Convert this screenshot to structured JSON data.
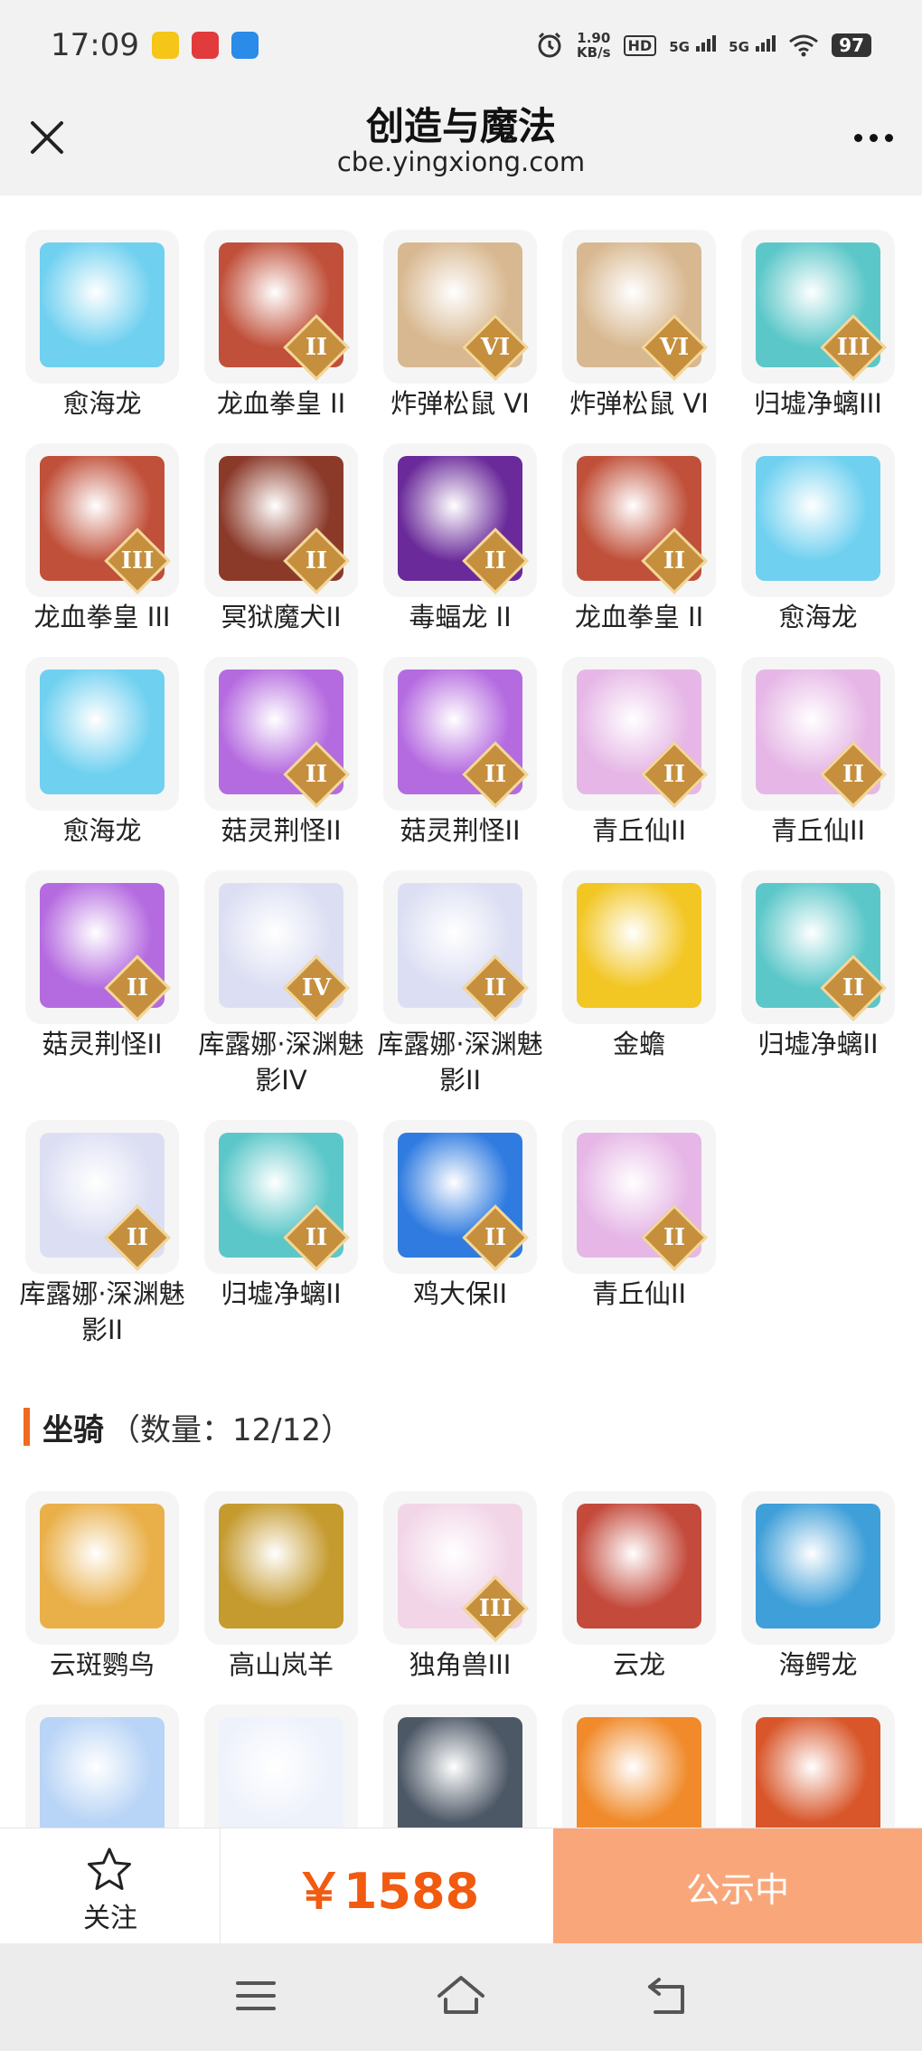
{
  "status": {
    "time": "17:09",
    "net_speed_value": "1.90",
    "net_speed_unit": "KB/s",
    "hd_label": "HD",
    "signal1": "5G",
    "signal2": "5G",
    "battery": "97"
  },
  "header": {
    "title": "创造与魔法",
    "subtitle": "cbe.yingxiong.com"
  },
  "pets": [
    {
      "name": "愈海龙",
      "badge": "",
      "icon": "blue-water-dragon",
      "color": "#6fd0f0"
    },
    {
      "name": "龙血拳皇 II",
      "badge": "II",
      "icon": "red-horned-beast",
      "color": "#c0503a"
    },
    {
      "name": "炸弹松鼠 VI",
      "badge": "VI",
      "icon": "hat-squirrel",
      "color": "#d8b890"
    },
    {
      "name": "炸弹松鼠 VI",
      "badge": "VI",
      "icon": "hat-squirrel",
      "color": "#d8b890"
    },
    {
      "name": "归墟净螭III",
      "badge": "III",
      "icon": "teal-serpent-dragon",
      "color": "#5cc7c9"
    },
    {
      "name": "龙血拳皇 III",
      "badge": "III",
      "icon": "red-horned-beast",
      "color": "#c0503a"
    },
    {
      "name": "冥狱魔犬II",
      "badge": "II",
      "icon": "hell-hound",
      "color": "#8b3a2a"
    },
    {
      "name": "毒蝠龙 II",
      "badge": "II",
      "icon": "purple-bat-dragon",
      "color": "#6a2a9a"
    },
    {
      "name": "龙血拳皇 II",
      "badge": "II",
      "icon": "red-horned-beast",
      "color": "#c0503a"
    },
    {
      "name": "愈海龙",
      "badge": "",
      "icon": "blue-water-dragon",
      "color": "#6fd0f0"
    },
    {
      "name": "愈海龙",
      "badge": "",
      "icon": "blue-water-dragon",
      "color": "#6fd0f0"
    },
    {
      "name": "菇灵荆怪II",
      "badge": "II",
      "icon": "purple-mushroom-spirit",
      "color": "#b56be0"
    },
    {
      "name": "菇灵荆怪II",
      "badge": "II",
      "icon": "purple-mushroom-spirit",
      "color": "#b56be0"
    },
    {
      "name": "青丘仙II",
      "badge": "II",
      "icon": "fox-fairy",
      "color": "#e6b7e6"
    },
    {
      "name": "青丘仙II",
      "badge": "II",
      "icon": "fox-fairy",
      "color": "#e6b7e6"
    },
    {
      "name": "菇灵荆怪II",
      "badge": "II",
      "icon": "purple-mushroom-spirit",
      "color": "#b56be0"
    },
    {
      "name": "库露娜·深渊魅影IV",
      "badge": "IV",
      "icon": "white-haired-spirit",
      "color": "#dcdff3"
    },
    {
      "name": "库露娜·深渊魅影II",
      "badge": "II",
      "icon": "white-haired-spirit",
      "color": "#dcdff3"
    },
    {
      "name": "金蟾",
      "badge": "",
      "icon": "golden-toad",
      "color": "#f2c623"
    },
    {
      "name": "归墟净螭II",
      "badge": "II",
      "icon": "teal-serpent-dragon",
      "color": "#5cc7c9"
    },
    {
      "name": "库露娜·深渊魅影II",
      "badge": "II",
      "icon": "white-haired-spirit",
      "color": "#dcdff3"
    },
    {
      "name": "归墟净螭II",
      "badge": "II",
      "icon": "teal-serpent-dragon",
      "color": "#5cc7c9"
    },
    {
      "name": "鸡大保II",
      "badge": "II",
      "icon": "blue-chicken",
      "color": "#2f7be0"
    },
    {
      "name": "青丘仙II",
      "badge": "II",
      "icon": "fox-fairy",
      "color": "#e6b7e6"
    }
  ],
  "mounts_section": {
    "label": "坐骑",
    "count": "（数量：12/12）"
  },
  "mounts": [
    {
      "name": "云斑鹦鸟",
      "badge": "",
      "icon": "golden-parrot",
      "color": "#e9b04a"
    },
    {
      "name": "高山岚羊",
      "badge": "",
      "icon": "mountain-goat",
      "color": "#c59a2e"
    },
    {
      "name": "独角兽III",
      "badge": "III",
      "icon": "unicorn",
      "color": "#f2d6e8"
    },
    {
      "name": "云龙",
      "badge": "",
      "icon": "cloud-dragon",
      "color": "#c44a3c"
    },
    {
      "name": "海鳄龙",
      "badge": "",
      "icon": "sea-croc-dragon",
      "color": "#3f9fd8"
    },
    {
      "name": "",
      "badge": "",
      "icon": "crowned-cloud-beast",
      "color": "#b8d4f6"
    },
    {
      "name": "",
      "badge": "",
      "icon": "white-swan",
      "color": "#eef2fb"
    },
    {
      "name": "",
      "badge": "",
      "icon": "mech-wolf",
      "color": "#4d5866"
    },
    {
      "name": "",
      "badge": "",
      "icon": "toucan-bird",
      "color": "#f08a2a"
    },
    {
      "name": "",
      "badge": "",
      "icon": "fire-dragon",
      "color": "#d8562a"
    }
  ],
  "bottom": {
    "follow_label": "关注",
    "price": "￥1588",
    "action_label": "公示中"
  },
  "colors": {
    "accent": "#f15a0f",
    "action_bg": "#f9a77a",
    "section_bar": "#f06a1f"
  }
}
